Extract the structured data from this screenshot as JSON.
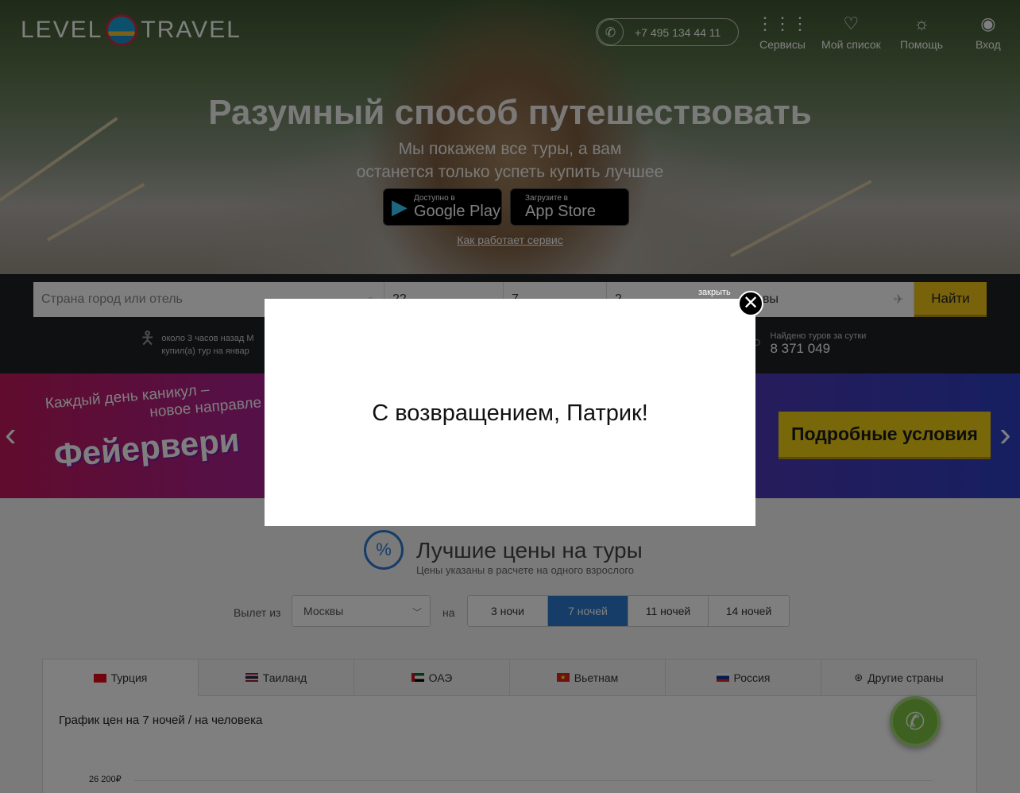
{
  "header": {
    "logo_left": "LEVEL",
    "logo_right": "TRAVEL",
    "phone": "+7 495 134 44 11",
    "nav": [
      {
        "label": "Сервисы",
        "icon": "grid-icon"
      },
      {
        "label": "Мой список",
        "icon": "heart-icon"
      },
      {
        "label": "Помощь",
        "icon": "lightbulb-icon"
      },
      {
        "label": "Вход",
        "icon": "user-icon"
      }
    ]
  },
  "hero": {
    "title": "Разумный способ путешествовать",
    "subtitle_line1": "Мы покажем все туры, а вам",
    "subtitle_line2": "останется только успеть купить лучшее",
    "google_small": "Доступно в",
    "google_big": "Google Play",
    "apple_small": "Загрузите в",
    "apple_big": "App Store",
    "how_link": "Как работает сервис"
  },
  "search": {
    "destination_placeholder": "Страна город или отель",
    "date_value": "22",
    "nights_value": "7",
    "tourists_value": "2",
    "departure_value": "вы",
    "find_button": "Найти",
    "sold_line1": "около 3 часов назад М",
    "sold_line2": "купил(а) тур на январ",
    "found_label": "Найдено туров за сутки",
    "found_value": "8 371 049"
  },
  "banner": {
    "slogan_line1": "Каждый день каникул –",
    "slogan_line2": "новое направле",
    "big_text": "Фейервери",
    "details_button": "Подробные условия"
  },
  "prices": {
    "title": "Лучшие цены на туры",
    "subtitle": "Цены указаны в расчете на одного взрослого",
    "departure_label": "Вылет из",
    "departure_city": "Москвы",
    "na": "на",
    "nights": [
      "3 ночи",
      "7 ночей",
      "11 ночей",
      "14 ночей"
    ],
    "active_nights_index": 1,
    "tabs": [
      "Турция",
      "Таиланд",
      "ОАЭ",
      "Вьетнам",
      "Россия",
      "Другие страны"
    ],
    "chart_title": "График цен на 7 ночей / на человека",
    "ytick": "26 200₽"
  },
  "modal": {
    "close_label": "закрыть",
    "message": "С возвращением, Патрик!"
  },
  "colors": {
    "accent_blue": "#2b7bd0",
    "find_yellow": "#f0c418",
    "call_green": "#7cc243"
  }
}
